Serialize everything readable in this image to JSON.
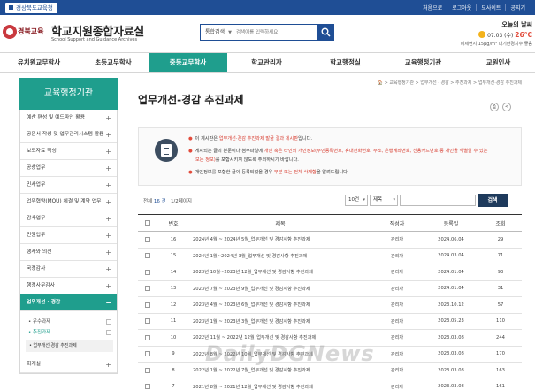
{
  "topbar": {
    "org_label": "경상북도교육청",
    "links": [
      "처음으로",
      "로그아웃",
      "모사이트",
      "공지기"
    ]
  },
  "header": {
    "logo_text": "경북교육",
    "site_title": "학교지원종합자료실",
    "site_subtitle": "School Support and Guidance Archives",
    "search": {
      "select_value": "통합검색",
      "placeholder": "검색어를 입력하세요"
    },
    "weather": {
      "title": "오늘의 날씨",
      "date": "07.03 (수)",
      "temp": "26°C",
      "air": "미세먼지 15μg/m³ 대기환경지수 좋음"
    }
  },
  "gnb": {
    "items": [
      "유치원교무학사",
      "초등교무학사",
      "중등교무학사",
      "학교관리자",
      "학교행정실",
      "교육행정기관",
      "교원인사"
    ],
    "active_index": 2
  },
  "lnb": {
    "title": "교육행정기관",
    "items": [
      "예산 편성 및 예드파인 활용",
      "공문서 작성 및 업무관리시스템 활용",
      "보도자료 작성",
      "공상업무",
      "민사업무",
      "업무협약(MOU) 체결 및 계약 업무",
      "감사업무",
      "민원업무",
      "행사와 의전",
      "국정감사",
      "행정사무감사",
      "업무개선 · 경감",
      "회계실"
    ],
    "active_label": "업무개선 · 경감",
    "sub_items": [
      "우수과제",
      "추진과제"
    ],
    "sub_sub_item": "업무개선·경감 추진과제"
  },
  "content": {
    "breadcrumb": "🏠 > 교육행정기관 > 업무개선 · 경감 > 추진과제 > 업무개선·경감 추진과제",
    "page_title": "업무개선-경감 추진과제",
    "notice": {
      "line1_pre": "이 게시판은 ",
      "line1_red": "업무개선·경감 추진과제 발굴 결과 게시판",
      "line1_post": "입니다.",
      "line2_pre": "게시되는 글의 본문이나 첨부파일에 ",
      "line2_red": "개인 혹은 타인의 개인정보(주민등록번호, 휴대전화번호, 주소, 은행계좌번호, 신용카드번호 등 개인을 식별할 수 있는",
      "line3_red": "모든 정보)",
      "line3_post": "를 포함시키지 않도록 주의하시기 바랍니다.",
      "line4_pre": "개인정보를 포함한 글이 등록되었을 경우 ",
      "line4_red": "부분 또는 전체 삭제함",
      "line4_post": "을 알려드립니다."
    },
    "list": {
      "total_label": "전체",
      "total_count": "16 건",
      "page_info": "1/2페이지",
      "page_size": "10건",
      "field": "제목",
      "search_button": "검색"
    },
    "table": {
      "headers": [
        "",
        "번호",
        "제목",
        "작성자",
        "등록일",
        "조회"
      ],
      "rows": [
        {
          "no": "16",
          "title": "2024년 4월 ~ 2024년 5월_업무개선 및 경감사항 추진과제",
          "author": "관리자",
          "date": "2024.06.04",
          "views": "29"
        },
        {
          "no": "15",
          "title": "2024년 1월~2024년 3월_업무개선 및 경감사항 추진과제",
          "author": "관리자",
          "date": "2024.03.04",
          "views": "71"
        },
        {
          "no": "14",
          "title": "2023년 10월~2023년 12월_업무개선 및 경감사항 추진과제",
          "author": "관리자",
          "date": "2024.01.04",
          "views": "93"
        },
        {
          "no": "13",
          "title": "2023년 7월 ~ 2023년 9월_업무개선 및 경감사항 추진과제",
          "author": "관리자",
          "date": "2024.01.04",
          "views": "31"
        },
        {
          "no": "12",
          "title": "2023년 4월 ~ 2023년 6월_업무개선 및 경감사항 추진과제",
          "author": "관리자",
          "date": "2023.10.12",
          "views": "57"
        },
        {
          "no": "11",
          "title": "2023년 1월 ~ 2023년 3월_업무개선 및 경감사항 추진과제",
          "author": "관리자",
          "date": "2023.05.23",
          "views": "110"
        },
        {
          "no": "10",
          "title": "2022년 11월 ~ 2022년 12월_업무개선 및 경감사항 추진과제",
          "author": "관리자",
          "date": "2023.03.08",
          "views": "244"
        },
        {
          "no": "9",
          "title": "2022년 8월 ~ 2022년 10월_업무개선 및 경감사항 추진과제",
          "author": "관리자",
          "date": "2023.03.08",
          "views": "170"
        },
        {
          "no": "8",
          "title": "2022년 1월 ~ 2022년 7월_업무개선 및 경감사항 추진과제",
          "author": "관리자",
          "date": "2023.03.08",
          "views": "163"
        },
        {
          "no": "7",
          "title": "2021년 8월 ~ 2021년 12월_업무개선 및 경감사항 추진과제",
          "author": "관리자",
          "date": "2023.03.08",
          "views": "161"
        }
      ]
    }
  },
  "watermark": "DailyDGNews",
  "colors": {
    "primary_blue": "#1f4e95",
    "teal": "#1f9e8d",
    "red": "#e24b3b",
    "dark_button": "#1e3a5c"
  },
  "icons": [
    "search-icon",
    "home-icon",
    "print-icon",
    "share-icon",
    "document-icon",
    "plus-icon",
    "sun-icon"
  ]
}
